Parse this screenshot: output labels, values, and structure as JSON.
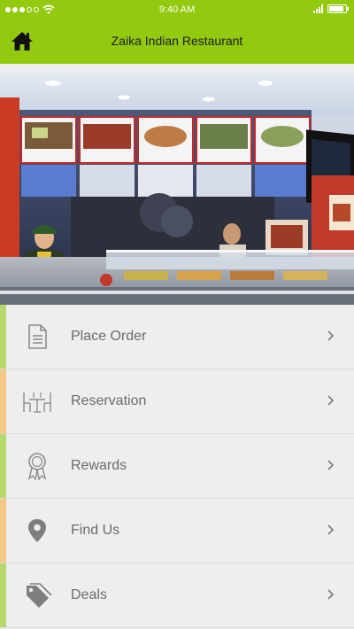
{
  "status": {
    "time": "9:40 AM",
    "battery_level": 0.9
  },
  "header": {
    "title": "Zaika Indian Restaurant",
    "home_icon": "home-icon"
  },
  "hero": {
    "image": "restaurant-counter-photo"
  },
  "menu": {
    "items": [
      {
        "label": "Place Order",
        "icon": "document-icon",
        "accent": "#b7d96c"
      },
      {
        "label": "Reservation",
        "icon": "dining-table-icon",
        "accent": "#f5c887"
      },
      {
        "label": "Rewards",
        "icon": "award-ribbon-icon",
        "accent": "#b7d96c"
      },
      {
        "label": "Find Us",
        "icon": "map-pin-icon",
        "accent": "#f5c887"
      },
      {
        "label": "Deals",
        "icon": "tag-icon",
        "accent": "#b7d96c"
      }
    ]
  },
  "colors": {
    "brand": "#93c90e",
    "background": "#eeeeee",
    "text": "#6b6b6b"
  }
}
